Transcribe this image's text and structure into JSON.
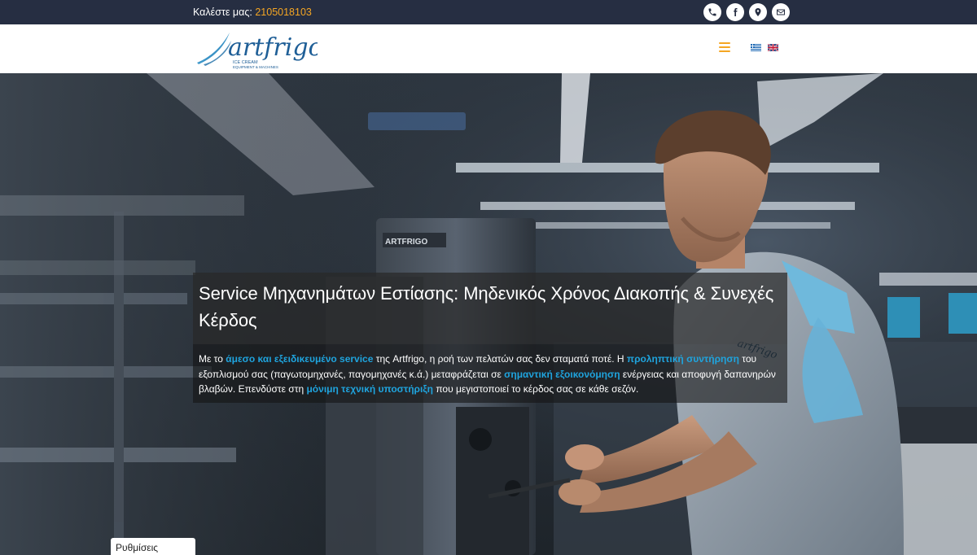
{
  "topbar": {
    "call_label": "Καλέστε μας:",
    "phone": "2105018103",
    "social_icons": [
      "phone-icon",
      "facebook-icon",
      "map-pin-icon",
      "mail-icon"
    ]
  },
  "header": {
    "logo_text": "artfrigo",
    "logo_tagline_1": "ICE CREAM",
    "logo_tagline_2": "EQUIPMENT & MACHINES",
    "menu_icon": "hamburger-menu-icon",
    "languages": [
      "el",
      "en"
    ]
  },
  "hero": {
    "machine_brand": "ARTFRIGO",
    "shirt_brand": "artfrigo",
    "title": "Service Μηχανημάτων Εστίασης: Μηδενικός Χρόνος Διακοπής & Συνεχές Κέρδος",
    "desc": {
      "p1": "Με το ",
      "h1": "άμεσο και εξειδικευμένο service",
      "p2": " της Artfrigo, η ροή των πελατών σας δεν σταματά ποτέ. Η ",
      "h2": "προληπτική συντήρηση",
      "p3": " του εξοπλισμού σας (παγωτομηχανές, παγομηχανές κ.ά.) μεταφράζεται σε ",
      "h3": "σημαντική εξοικονόμηση",
      "p4": " ενέργειας και αποφυγή δαπανηρών βλαβών. Επενδύστε στη ",
      "h4": "μόνιμη τεχνική υποστήριξη",
      "p5": " που μεγιστοποιεί το κέρδος σας σε κάθε σεζόν."
    }
  },
  "cookie_button": "Ρυθμίσεις Cookies",
  "colors": {
    "topbar_bg": "#262e42",
    "accent_orange": "#f5a623",
    "link_blue": "#1fa4de",
    "logo_blue": "#1f6fa8"
  }
}
